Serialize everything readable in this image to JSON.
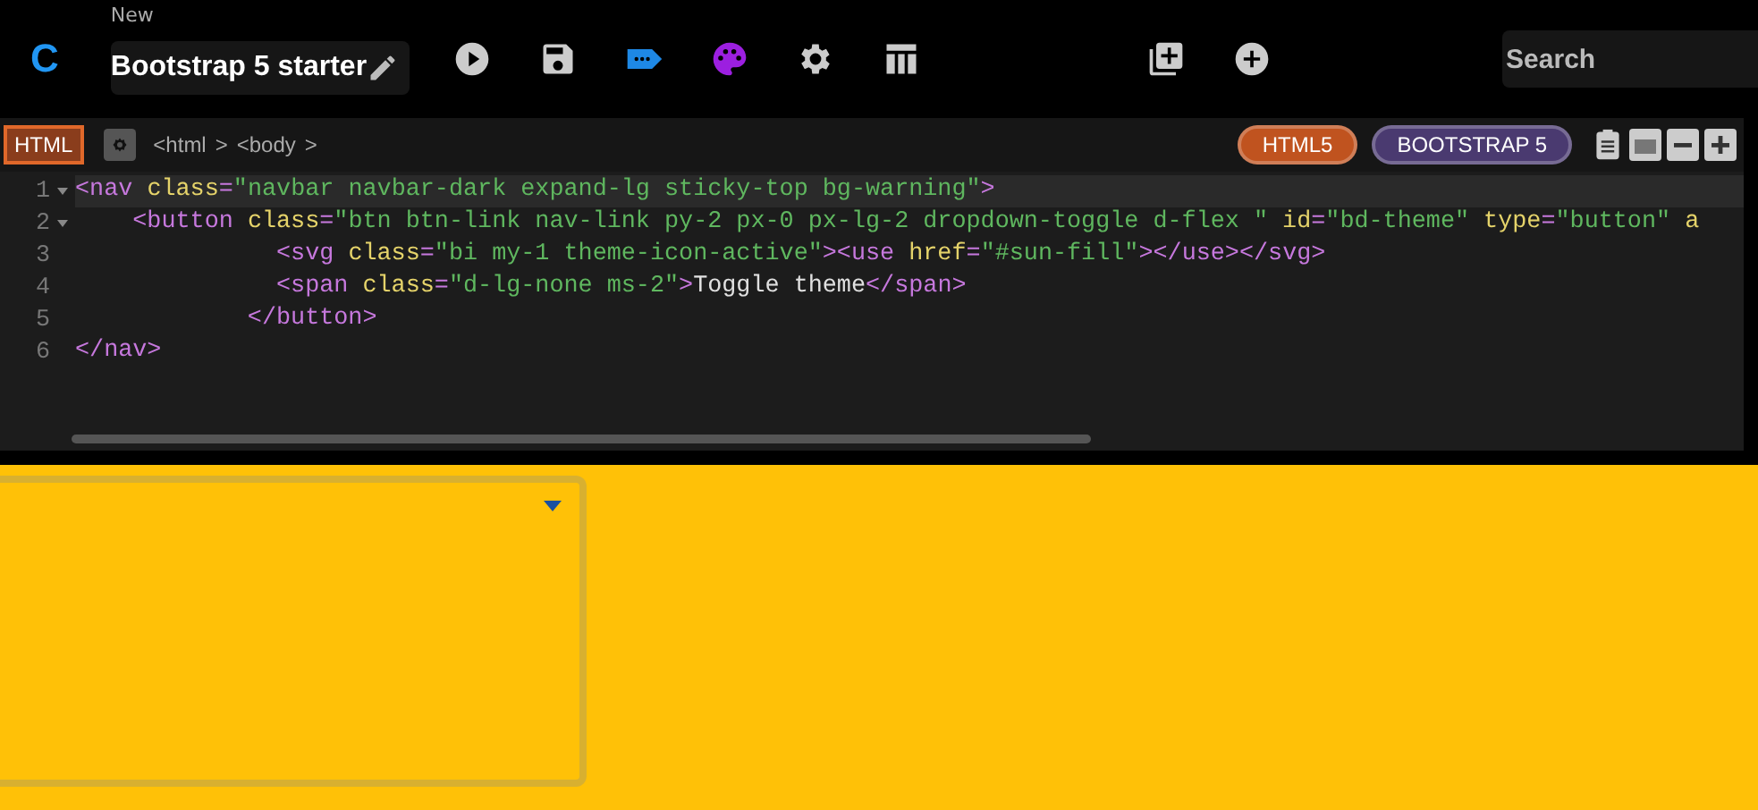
{
  "header": {
    "logo": "C",
    "title_caption": "New",
    "title": "Bootstrap 5 starter",
    "search": {
      "placeholder": "Search"
    }
  },
  "editor": {
    "tab": {
      "label": "HTML",
      "selected": true
    },
    "breadcrumb": [
      "<html",
      ">",
      "<body",
      ">"
    ],
    "badges": [
      {
        "label": "HTML5",
        "color": "#c0531f"
      },
      {
        "label": "BOOTSTRAP 5",
        "color": "#4a3a70"
      }
    ],
    "lines": [
      {
        "number": "1",
        "foldable": true,
        "active": true,
        "tokens": [
          {
            "kind": "tag",
            "text": "<nav"
          },
          {
            "kind": "attr",
            "text": " class"
          },
          {
            "kind": "eq",
            "text": "="
          },
          {
            "kind": "str",
            "text": "\"navbar navbar-dark expand-lg sticky-top bg-warning\""
          },
          {
            "kind": "tag",
            "text": ">"
          }
        ]
      },
      {
        "number": "2",
        "foldable": true,
        "active": false,
        "tokens": [
          {
            "kind": "tag",
            "text": "    <button"
          },
          {
            "kind": "attr",
            "text": " class"
          },
          {
            "kind": "eq",
            "text": "="
          },
          {
            "kind": "str",
            "text": "\"btn btn-link nav-link py-2 px-0 px-lg-2 dropdown-toggle d-flex \""
          },
          {
            "kind": "attr",
            "text": " id"
          },
          {
            "kind": "eq",
            "text": "="
          },
          {
            "kind": "str",
            "text": "\"bd-theme\""
          },
          {
            "kind": "attr",
            "text": " type"
          },
          {
            "kind": "eq",
            "text": "="
          },
          {
            "kind": "str",
            "text": "\"button\""
          },
          {
            "kind": "attr",
            "text": " a"
          }
        ]
      },
      {
        "number": "3",
        "foldable": false,
        "active": false,
        "tokens": [
          {
            "kind": "tag",
            "text": "              <svg"
          },
          {
            "kind": "attr",
            "text": " class"
          },
          {
            "kind": "eq",
            "text": "="
          },
          {
            "kind": "str",
            "text": "\"bi my-1 theme-icon-active\""
          },
          {
            "kind": "tag",
            "text": "><use"
          },
          {
            "kind": "attr",
            "text": " href"
          },
          {
            "kind": "eq",
            "text": "="
          },
          {
            "kind": "str",
            "text": "\"#sun-fill\""
          },
          {
            "kind": "tag",
            "text": "></use></svg>"
          }
        ]
      },
      {
        "number": "4",
        "foldable": false,
        "active": false,
        "tokens": [
          {
            "kind": "tag",
            "text": "              <span"
          },
          {
            "kind": "attr",
            "text": " class"
          },
          {
            "kind": "eq",
            "text": "="
          },
          {
            "kind": "str",
            "text": "\"d-lg-none ms-2\""
          },
          {
            "kind": "tag",
            "text": ">"
          },
          {
            "kind": "text",
            "text": "Toggle theme"
          },
          {
            "kind": "tag",
            "text": "</span>"
          }
        ]
      },
      {
        "number": "5",
        "foldable": false,
        "active": false,
        "tokens": [
          {
            "kind": "tag",
            "text": "            </button>"
          }
        ]
      },
      {
        "number": "6",
        "foldable": false,
        "active": false,
        "tokens": [
          {
            "kind": "tag",
            "text": "</nav>"
          }
        ]
      }
    ]
  }
}
